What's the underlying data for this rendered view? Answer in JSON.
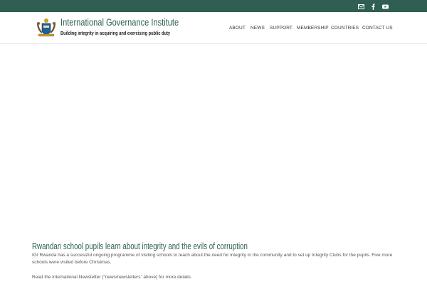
{
  "topbar": {
    "icons": [
      {
        "name": "mail-icon",
        "color": "#ffffff"
      },
      {
        "name": "facebook-icon",
        "color": "#ffffff"
      },
      {
        "name": "youtube-icon",
        "color": "#ffffff"
      }
    ],
    "background": "#2e5f52"
  },
  "header": {
    "site_title": "International Governance Institute",
    "tagline": "Building integrity in acquiring and exercising public duty",
    "logo_icon": "coat-of-arms-icon",
    "brand_color": "#2e5f52"
  },
  "nav": {
    "items": [
      {
        "label": "ABOUT"
      },
      {
        "label": "NEWS"
      },
      {
        "label": "SUPPORT"
      },
      {
        "label": "MEMBERSHIP"
      },
      {
        "label": "COUNTRIES"
      },
      {
        "label": "CONTACT US"
      }
    ]
  },
  "article": {
    "title": "Rwandan school pupils learn about integrity and the evils of corruption",
    "paragraph_1": "IGI Rwanda has a successful ongoing programme of visiting schools to teach about the need for integrity in the community and to set up Integrity Clubs for the pupils.  Five more schools were visited before Christmas.",
    "paragraph_2": "Read the International Newsletter (“news/newsletters” above) for more details."
  }
}
